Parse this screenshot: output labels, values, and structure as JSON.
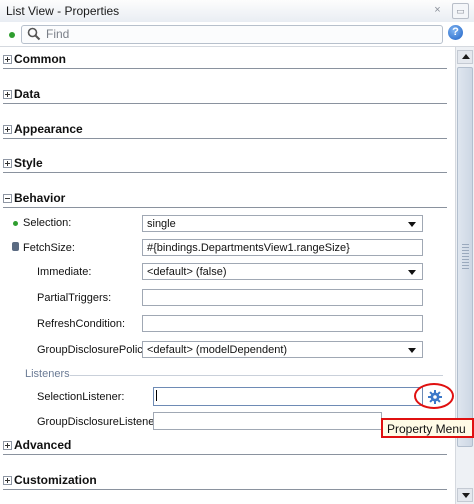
{
  "window": {
    "title": "List View - Properties",
    "close_glyph": "×",
    "minimize_glyph": "▭"
  },
  "search": {
    "placeholder": "Find",
    "value": ""
  },
  "help": {
    "glyph": "?"
  },
  "sections": {
    "common": "Common",
    "data": "Data",
    "appearance": "Appearance",
    "style": "Style",
    "behavior": "Behavior",
    "advanced": "Advanced",
    "customization": "Customization"
  },
  "behavior": {
    "selection": {
      "label": "Selection:",
      "value": "single"
    },
    "fetchsize": {
      "label": "FetchSize:",
      "value": "#{bindings.DepartmentsView1.rangeSize}"
    },
    "immediate": {
      "label": "Immediate:",
      "value": "<default> (false)"
    },
    "partialtriggers": {
      "label": "PartialTriggers:",
      "value": ""
    },
    "refreshcondition": {
      "label": "RefreshCondition:",
      "value": ""
    },
    "groupdisclosurepolicy": {
      "label": "GroupDisclosurePolicy:",
      "value": "<default> (modelDependent)"
    }
  },
  "listeners": {
    "group_label": "Listeners",
    "selectionlistener": {
      "label": "SelectionListener:",
      "value": ""
    },
    "groupdisclosurelistener": {
      "label": "GroupDisclosureListener:",
      "value": ""
    }
  },
  "tooltip": {
    "text": "Property Menu"
  },
  "colors": {
    "required_dot": "#2f9e2f",
    "highlight": "#e01010",
    "help": "#1f62c5"
  }
}
